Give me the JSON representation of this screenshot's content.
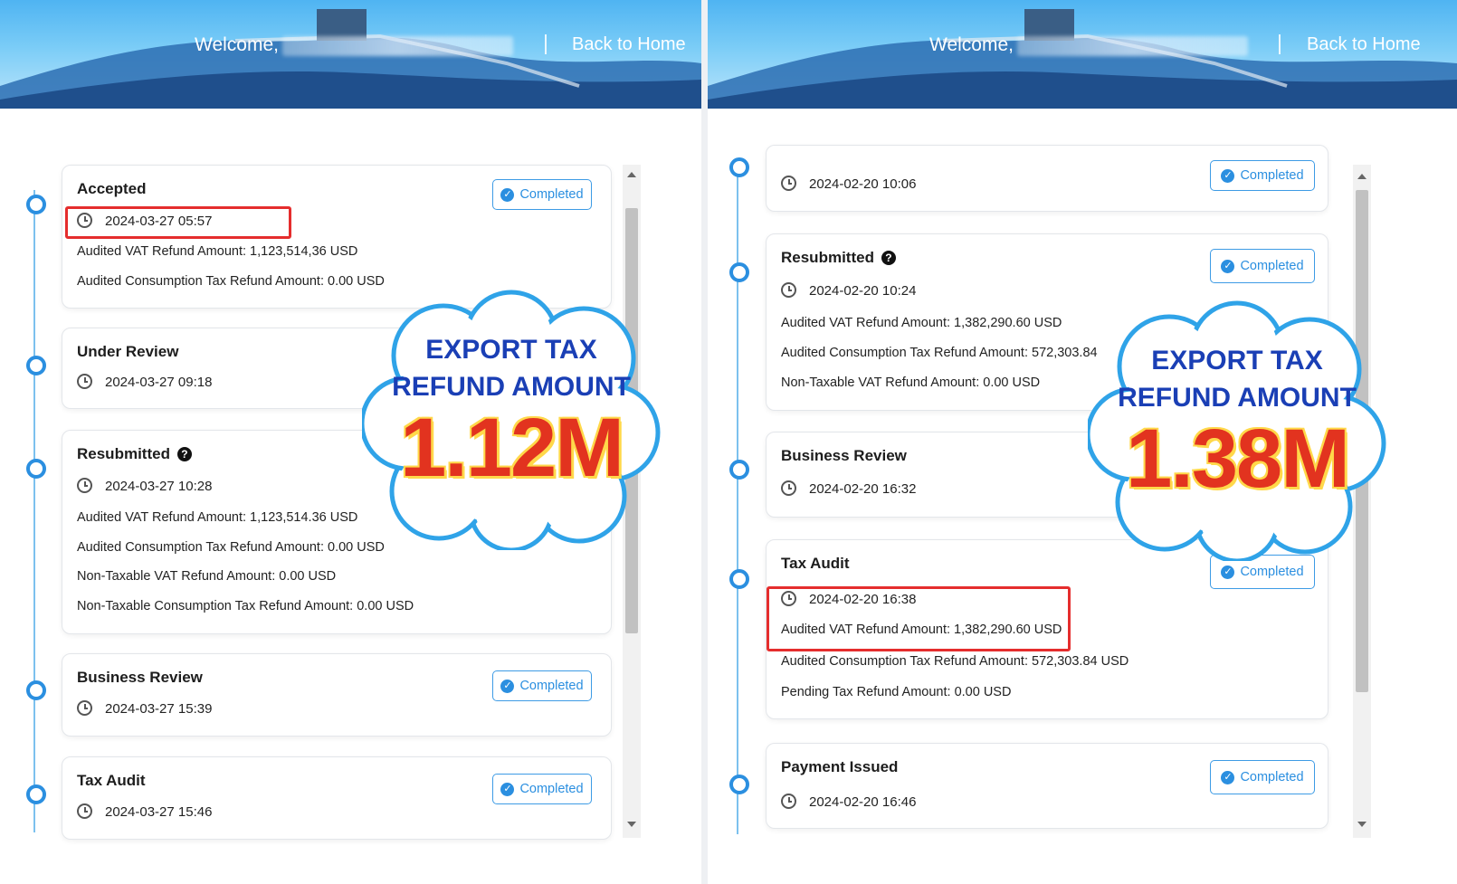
{
  "header": {
    "welcome": "Welcome,",
    "back_link": "Back to Home"
  },
  "status_label": "Completed",
  "left": {
    "promo": {
      "line1": "EXPORT TAX",
      "line2": "REFUND AMOUNT",
      "value": "1.12M"
    },
    "steps": [
      {
        "title": "Accepted",
        "time": "2024-03-27 05:57",
        "amounts": [
          "Audited VAT Refund Amount: 1,123,514,36 USD",
          "Audited Consumption Tax Refund Amount: 0.00 USD"
        ]
      },
      {
        "title": "Under Review",
        "time": "2024-03-27 09:18"
      },
      {
        "title": "Resubmitted",
        "time": "2024-03-27 10:28",
        "amounts": [
          "Audited VAT Refund Amount: 1,123,514.36 USD",
          "Audited Consumption Tax Refund Amount: 0.00 USD",
          "Non-Taxable VAT Refund Amount: 0.00 USD",
          "Non-Taxable Consumption Tax Refund Amount: 0.00 USD"
        ]
      },
      {
        "title": "Business Review",
        "time": "2024-03-27 15:39"
      },
      {
        "title": "Tax Audit",
        "time": "2024-03-27 15:46"
      }
    ]
  },
  "right": {
    "promo": {
      "line1": "EXPORT TAX",
      "line2": "REFUND AMOUNT",
      "value": "1.38M"
    },
    "steps": [
      {
        "time": "2024-02-20 10:06"
      },
      {
        "title": "Resubmitted",
        "time": "2024-02-20 10:24",
        "amounts": [
          "Audited VAT Refund Amount: 1,382,290.60 USD",
          "Audited Consumption Tax Refund Amount: 572,303.84",
          "Non-Taxable VAT Refund Amount: 0.00 USD"
        ]
      },
      {
        "title": "Business Review",
        "time": "2024-02-20 16:32"
      },
      {
        "title": "Tax Audit",
        "time": "2024-02-20 16:38",
        "amounts": [
          "Audited VAT Refund Amount: 1,382,290.60 USD",
          "Audited Consumption Tax Refund Amount: 572,303.84 USD",
          "Pending Tax Refund Amount: 0.00 USD"
        ]
      },
      {
        "title": "Payment Issued",
        "time": "2024-02-20 16:46"
      }
    ]
  },
  "colors": {
    "accent": "#2b8fe0",
    "highlight": "#e52d2d",
    "promo_text": "#1a3fb5",
    "promo_value": "#e2331f"
  }
}
